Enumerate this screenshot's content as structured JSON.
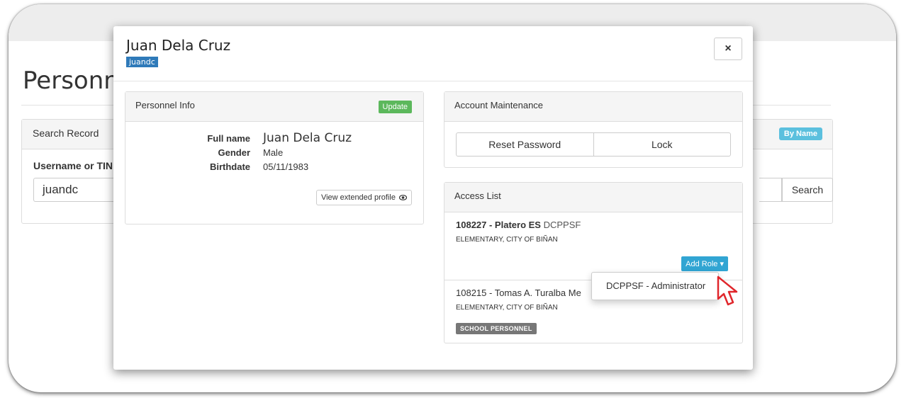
{
  "background": {
    "page_title": "Personn",
    "search_panel": {
      "title": "Search Record",
      "mode_badge": "By Name",
      "field_label": "Username or TIN",
      "field_value": "juandc",
      "search_button": "Search"
    }
  },
  "modal": {
    "title": "Juan Dela Cruz",
    "username": "juandc",
    "close_label": "×",
    "personnel_info": {
      "title": "Personnel Info",
      "update_button": "Update",
      "fields": [
        {
          "label": "Full name",
          "value": "Juan Dela Cruz"
        },
        {
          "label": "Gender",
          "value": "Male"
        },
        {
          "label": "Birthdate",
          "value": "05/11/1983"
        }
      ],
      "extended_profile_button": "View extended profile"
    },
    "account_maintenance": {
      "title": "Account Maintenance",
      "reset_password_button": "Reset Password",
      "lock_button": "Lock"
    },
    "access_list": {
      "title": "Access List",
      "items": [
        {
          "code_name": "108227 - Platero ES",
          "system": "DCPPSF",
          "location": "ELEMENTARY, CITY OF BIÑAN",
          "add_role_button": "Add Role ▾"
        },
        {
          "code_name": "108215 - Tomas A. Turalba Me",
          "location": "ELEMENTARY, CITY OF BIÑAN",
          "role_badge": "SCHOOL PERSONNEL"
        }
      ]
    },
    "add_role_dropdown": {
      "options": [
        "DCPPSF - Administrator"
      ]
    }
  },
  "colors": {
    "update": "#5cb85c",
    "info_badge": "#5bc0de",
    "add_role": "#31a5d3",
    "username_tag": "#2f7ab9",
    "cursor": "#e0262b"
  }
}
